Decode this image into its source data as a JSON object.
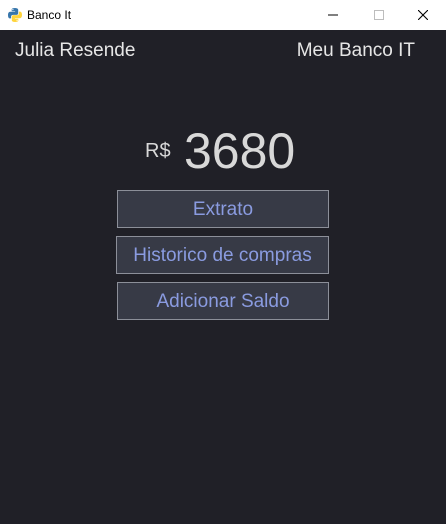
{
  "window": {
    "title": "Banco It",
    "icon": "python-icon",
    "controls": [
      "minimize-icon",
      "maximize-icon",
      "close-icon"
    ]
  },
  "header": {
    "user_name": "Julia Resende",
    "bank_name": "Meu Banco IT"
  },
  "balance": {
    "currency": "R$",
    "amount": "3680"
  },
  "actions": {
    "extrato": "Extrato",
    "historico": "Historico de compras",
    "adicionar_saldo": "Adicionar Saldo"
  },
  "colors": {
    "background": "#202027",
    "button_bg": "#373a46",
    "button_text": "#8a9be0",
    "text": "#e6e6e6"
  }
}
